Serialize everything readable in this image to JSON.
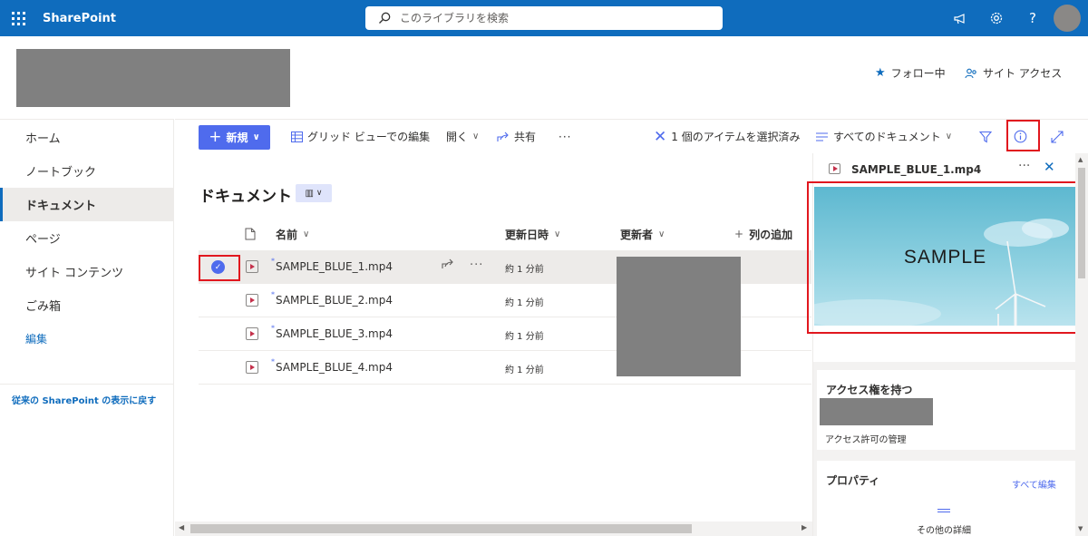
{
  "suite": {
    "app_name": "SharePoint",
    "search_placeholder": "このライブラリを検索",
    "icons": [
      "waffle-icon",
      "megaphone-icon",
      "gear-icon",
      "help-icon"
    ],
    "help_glyph": "?"
  },
  "site": {
    "follow_label": "フォロー中",
    "site_access_label": "サイト アクセス"
  },
  "nav": {
    "items": [
      {
        "label": "ホーム",
        "active": false
      },
      {
        "label": "ノートブック",
        "active": false
      },
      {
        "label": "ドキュメント",
        "active": true
      },
      {
        "label": "ページ",
        "active": false
      },
      {
        "label": "サイト コンテンツ",
        "active": false
      },
      {
        "label": "ごみ箱",
        "active": false
      }
    ],
    "edit_label": "編集",
    "classic_link": "従来の SharePoint の表示に戻す"
  },
  "commands": {
    "new_label": "新規",
    "grid_edit_label": "グリッド ビューでの編集",
    "open_label": "開く",
    "share_label": "共有",
    "more_glyph": "···",
    "selection_label": "1 個のアイテムを選択済み",
    "view_label": "すべてのドキュメント"
  },
  "library": {
    "title": "ドキュメント",
    "columns": {
      "name": "名前",
      "modified": "更新日時",
      "modified_by": "更新者",
      "add_column": "列の追加"
    },
    "files": [
      {
        "name": "SAMPLE_BLUE_1.mp4",
        "modified": "約 1 分前",
        "selected": true
      },
      {
        "name": "SAMPLE_BLUE_2.mp4",
        "modified": "約 1 分前",
        "selected": false
      },
      {
        "name": "SAMPLE_BLUE_3.mp4",
        "modified": "約 1 分前",
        "selected": false
      },
      {
        "name": "SAMPLE_BLUE_4.mp4",
        "modified": "約 1 分前",
        "selected": false
      }
    ]
  },
  "details": {
    "file_name": "SAMPLE_BLUE_1.mp4",
    "preview_text": "SAMPLE",
    "access_title": "アクセス権を持つ",
    "manage_access": "アクセス許可の管理",
    "properties_title": "プロパティ",
    "edit_all": "すべて編集",
    "more_details": "その他の詳細"
  },
  "colors": {
    "suite_bar": "#0f6cbd",
    "accent": "#4f6bed",
    "highlight_box": "#e1171e",
    "redaction": "#808080"
  }
}
